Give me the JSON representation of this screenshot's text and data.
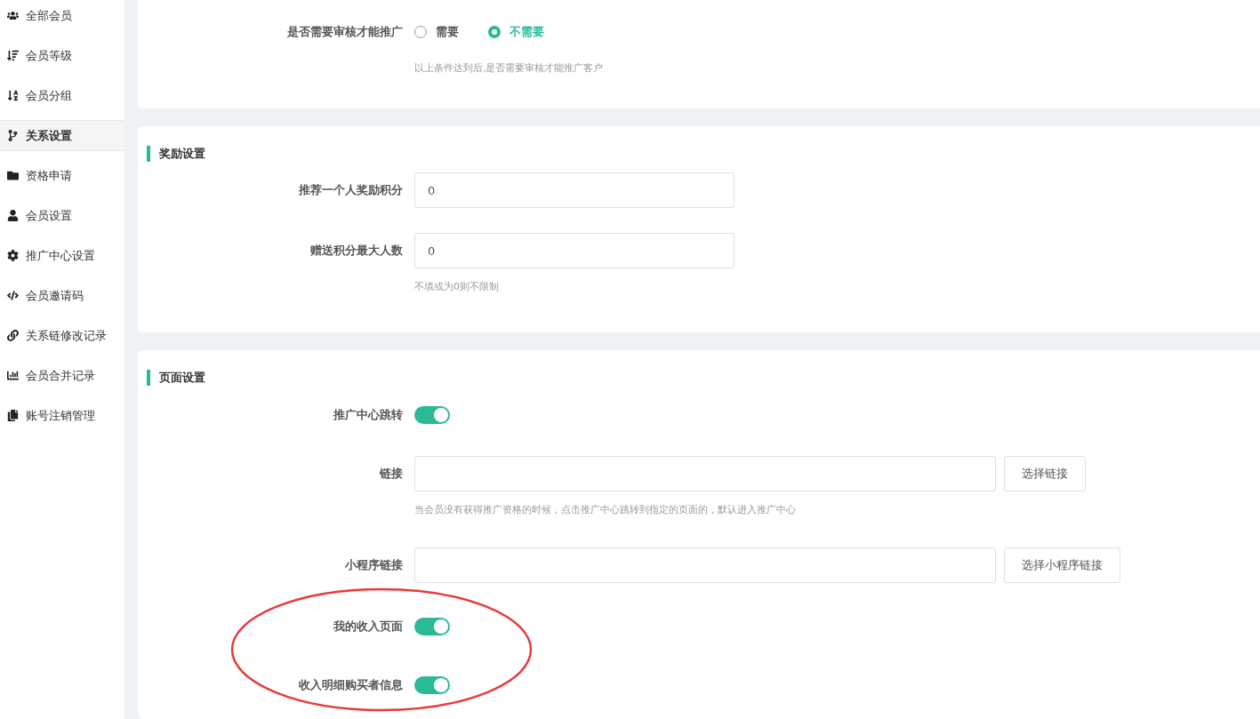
{
  "sidebar": {
    "items": [
      {
        "label": "全部会员",
        "selected": false
      },
      {
        "label": "会员等级",
        "selected": false
      },
      {
        "label": "会员分组",
        "selected": false
      },
      {
        "label": "关系设置",
        "selected": true
      },
      {
        "label": "资格申请",
        "selected": false
      },
      {
        "label": "会员设置",
        "selected": false
      },
      {
        "label": "推广中心设置",
        "selected": false
      },
      {
        "label": "会员邀请码",
        "selected": false
      },
      {
        "label": "关系链修改记录",
        "selected": false
      },
      {
        "label": "会员合并记录",
        "selected": false
      },
      {
        "label": "账号注销管理",
        "selected": false
      }
    ]
  },
  "sections": [
    {
      "rows": [
        {
          "kind": "radio",
          "label": "是否需要审核才能推广",
          "options": [
            {
              "label": "需要",
              "selected": false
            },
            {
              "label": "不需要",
              "selected": true
            }
          ],
          "hint": "以上条件达到后,是否需要审核才能推广客户"
        }
      ]
    },
    {
      "title": "奖励设置",
      "rows": [
        {
          "kind": "input",
          "label": "推荐一个人奖励积分",
          "value": "0"
        },
        {
          "kind": "input",
          "label": "赠送积分最大人数",
          "value": "0",
          "hint": "不填或为0则不限制"
        }
      ]
    },
    {
      "title": "页面设置",
      "rows": [
        {
          "kind": "toggle",
          "label": "推广中心跳转",
          "on": true
        },
        {
          "kind": "link",
          "label": "链接",
          "button": "选择链接",
          "hint": "当会员没有获得推广资格的时候，点击推广中心跳转到指定的页面的，默认进入推广中心"
        },
        {
          "kind": "link",
          "label": "小程序链接",
          "button": "选择小程序链接"
        },
        {
          "kind": "toggle",
          "label": "我的收入页面",
          "on": true
        },
        {
          "kind": "toggle",
          "label": "收入明细购买者信息",
          "on": true
        }
      ]
    }
  ]
}
